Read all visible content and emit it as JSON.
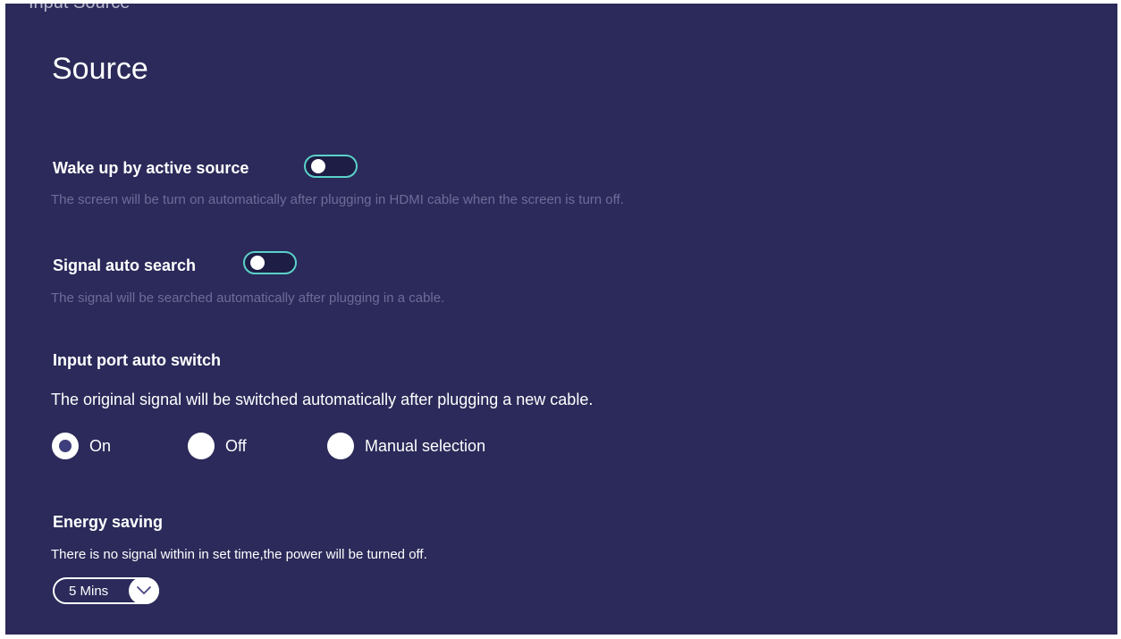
{
  "header": {
    "cut_off_title": "Input Source",
    "page_title": "Source"
  },
  "settings": {
    "wake_up": {
      "label": "Wake up by active source",
      "description": "The screen will be turn on automatically after plugging in HDMI cable when the screen is turn off.",
      "enabled": false
    },
    "signal_search": {
      "label": "Signal auto search",
      "description": "The signal will be searched automatically after plugging in a cable.",
      "enabled": false
    },
    "port_switch": {
      "label": "Input port auto switch",
      "description": "The original signal will be switched automatically after plugging a new cable.",
      "options": [
        "On",
        "Off",
        "Manual selection"
      ],
      "selected": "On"
    },
    "energy_saving": {
      "label": "Energy saving",
      "description": "There is no signal within in set time,the power will be turned off.",
      "selected_value": "5 Mins"
    }
  },
  "icons": {
    "dropdown": "chevron-down-icon"
  },
  "colors": {
    "background": "#2b2a5a",
    "toggle_border": "#5ad1c8",
    "description_dim": "#6e6c98",
    "radio_dot": "#3f3e7d"
  }
}
